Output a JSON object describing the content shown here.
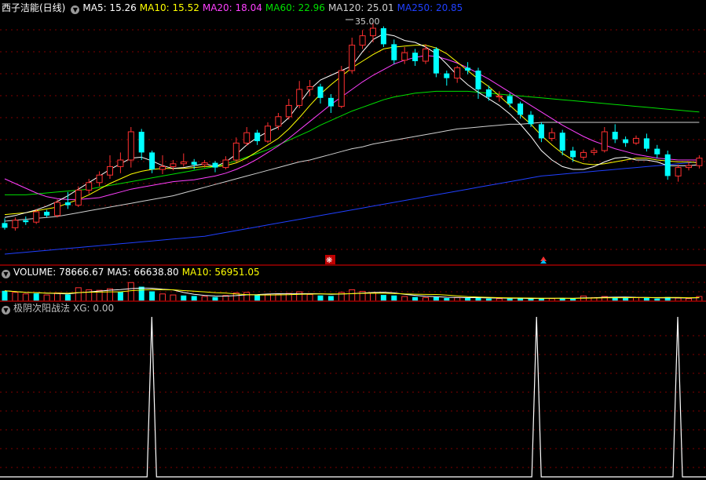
{
  "main_panel": {
    "title": "西子洁能(日线)",
    "ma_items": [
      {
        "label": "MA5: 15.26",
        "color": "#ffffff"
      },
      {
        "label": "MA10: 15.52",
        "color": "#ffff00"
      },
      {
        "label": "MA20: 18.04",
        "color": "#ff40ff"
      },
      {
        "label": "MA60: 22.96",
        "color": "#00e000"
      },
      {
        "label": "MA120: 25.01",
        "color": "#d0d0d0"
      },
      {
        "label": "MA250: 20.85",
        "color": "#2040ff"
      }
    ],
    "peak_label": "35.00",
    "marker_symbol": "❋"
  },
  "volume_panel": {
    "items": [
      {
        "label": "VOLUME: 78666.67",
        "color": "#ffffff"
      },
      {
        "label": "MA5: 66638.80",
        "color": "#ffffff"
      },
      {
        "label": "MA10: 56951.05",
        "color": "#ffff00"
      }
    ]
  },
  "indicator_panel": {
    "title": "极阴次阳战法",
    "value": "XG: 0.00",
    "title_color": "#c0c0c0"
  },
  "colors": {
    "up": "#ff3030",
    "down": "#00ffff",
    "grid": "#800000",
    "separator": "#a00000"
  },
  "chart_data": {
    "type": "candlestick",
    "price_range": [
      10.5,
      36.5
    ],
    "ma_series": {
      "ma5": [
        14.9,
        15.1,
        15.4,
        15.7,
        16.1,
        16.6,
        17.2,
        17.9,
        18.6,
        19.3,
        20.0,
        20.6,
        21.2,
        21.3,
        20.9,
        20.4,
        20.1,
        20.2,
        20.4,
        20.6,
        20.3,
        20.8,
        21.6,
        22.6,
        23.4,
        24.0,
        24.5,
        25.5,
        27.0,
        28.5,
        29.5,
        30.0,
        30.5,
        31.0,
        32.5,
        33.8,
        34.4,
        34.2,
        33.7,
        33.5,
        33.0,
        32.3,
        31.2,
        30.0,
        29.0,
        28.2,
        27.5,
        26.8,
        25.9,
        24.8,
        23.5,
        22.0,
        21.0,
        20.3,
        20.0,
        20.0,
        20.3,
        20.8,
        21.2,
        21.3,
        21.0,
        21.0,
        20.8,
        20.4,
        20.4,
        20.4,
        20.5
      ],
      "ma10": [
        15.2,
        15.3,
        15.4,
        15.6,
        15.8,
        16.0,
        16.4,
        16.8,
        17.3,
        17.9,
        18.5,
        19.0,
        19.5,
        19.8,
        20.0,
        20.1,
        20.1,
        20.1,
        20.2,
        20.3,
        20.3,
        20.4,
        20.7,
        21.2,
        21.9,
        22.6,
        23.3,
        24.3,
        25.5,
        26.8,
        28.0,
        29.0,
        29.9,
        30.8,
        31.5,
        32.2,
        32.8,
        33.0,
        33.1,
        33.2,
        33.2,
        32.9,
        32.3,
        31.4,
        30.5,
        29.6,
        28.8,
        27.8,
        26.8,
        25.8,
        24.8,
        23.6,
        22.6,
        21.7,
        21.0,
        20.6,
        20.5,
        20.6,
        20.8,
        21.0,
        21.2,
        21.2,
        21.0,
        20.9,
        20.8,
        20.8,
        20.7
      ],
      "ma20": [
        19.0,
        18.5,
        18.0,
        17.5,
        17.1,
        16.9,
        16.8,
        16.8,
        16.9,
        17.0,
        17.3,
        17.6,
        17.9,
        18.1,
        18.3,
        18.5,
        18.7,
        18.8,
        18.9,
        19.1,
        19.3,
        19.6,
        20.0,
        20.5,
        21.1,
        21.8,
        22.5,
        23.3,
        24.2,
        25.1,
        26.0,
        26.9,
        27.7,
        28.5,
        29.3,
        30.0,
        30.6,
        31.2,
        31.6,
        31.9,
        32.1,
        32.0,
        31.7,
        31.3,
        30.8,
        30.2,
        29.6,
        28.9,
        28.2,
        27.5,
        26.8,
        26.1,
        25.4,
        24.7,
        24.1,
        23.5,
        23.0,
        22.6,
        22.2,
        21.9,
        21.6,
        21.4,
        21.2,
        21.1,
        21.0,
        21.0,
        21.0
      ],
      "ma60": [
        17.3,
        17.3,
        17.3,
        17.4,
        17.5,
        17.6,
        17.7,
        17.8,
        17.9,
        18.1,
        18.3,
        18.5,
        18.7,
        18.9,
        19.1,
        19.3,
        19.5,
        19.7,
        19.9,
        20.1,
        20.3,
        20.6,
        20.9,
        21.3,
        21.7,
        22.1,
        22.6,
        23.1,
        23.6,
        24.1,
        24.7,
        25.2,
        25.7,
        26.2,
        26.6,
        27.0,
        27.4,
        27.7,
        27.9,
        28.1,
        28.2,
        28.3,
        28.3,
        28.3,
        28.3,
        28.2,
        28.1,
        28.0,
        27.9,
        27.8,
        27.7,
        27.6,
        27.5,
        27.4,
        27.3,
        27.2,
        27.1,
        27.0,
        26.9,
        26.8,
        26.7,
        26.6,
        26.5,
        26.4,
        26.3,
        26.2,
        26.1
      ],
      "ma120": [
        14.5,
        14.6,
        14.7,
        14.8,
        14.9,
        15.0,
        15.2,
        15.4,
        15.6,
        15.8,
        16.0,
        16.2,
        16.4,
        16.6,
        16.8,
        17.0,
        17.2,
        17.5,
        17.8,
        18.1,
        18.4,
        18.7,
        19.0,
        19.3,
        19.6,
        19.9,
        20.2,
        20.5,
        20.8,
        21.0,
        21.3,
        21.6,
        21.9,
        22.2,
        22.4,
        22.7,
        22.9,
        23.1,
        23.3,
        23.5,
        23.7,
        23.9,
        24.1,
        24.3,
        24.4,
        24.5,
        24.6,
        24.7,
        24.8,
        24.8,
        24.9,
        25.0,
        25.0,
        25.0,
        25.0,
        25.0,
        25.0,
        25.0,
        25.0,
        25.0,
        25.0,
        25.0,
        25.0,
        25.0,
        25.0,
        25.0,
        25.0
      ],
      "ma250": [
        11.0,
        11.1,
        11.2,
        11.3,
        11.4,
        11.5,
        11.6,
        11.7,
        11.8,
        11.9,
        12.0,
        12.1,
        12.2,
        12.3,
        12.4,
        12.5,
        12.6,
        12.7,
        12.8,
        12.9,
        13.1,
        13.3,
        13.5,
        13.7,
        13.9,
        14.1,
        14.3,
        14.5,
        14.7,
        14.9,
        15.1,
        15.3,
        15.5,
        15.7,
        15.9,
        16.1,
        16.3,
        16.5,
        16.7,
        16.9,
        17.1,
        17.3,
        17.5,
        17.7,
        17.9,
        18.1,
        18.3,
        18.5,
        18.7,
        18.9,
        19.1,
        19.3,
        19.4,
        19.5,
        19.6,
        19.7,
        19.8,
        19.9,
        20.0,
        20.1,
        20.2,
        20.3,
        20.4,
        20.5,
        20.6,
        20.7,
        20.85
      ]
    },
    "candles_ohlc": [
      [
        14.3,
        13.8,
        14.8,
        13.6
      ],
      [
        13.8,
        14.6,
        14.9,
        13.5
      ],
      [
        14.6,
        14.4,
        15.0,
        14.1
      ],
      [
        14.4,
        15.5,
        15.8,
        14.2
      ],
      [
        15.5,
        15.1,
        15.7,
        14.9
      ],
      [
        15.1,
        16.5,
        16.8,
        14.9
      ],
      [
        16.5,
        16.2,
        17.6,
        15.8
      ],
      [
        16.2,
        17.8,
        18.2,
        16.0
      ],
      [
        17.8,
        18.6,
        19.0,
        17.4
      ],
      [
        18.6,
        19.4,
        19.8,
        18.2
      ],
      [
        19.4,
        20.3,
        21.5,
        19.0
      ],
      [
        20.3,
        21.0,
        21.8,
        19.6
      ],
      [
        21.0,
        24.0,
        24.5,
        20.2
      ],
      [
        24.0,
        21.8,
        24.3,
        21.0
      ],
      [
        21.8,
        20.0,
        22.0,
        19.6
      ],
      [
        20.0,
        20.3,
        21.5,
        19.5
      ],
      [
        20.3,
        20.6,
        21.0,
        19.9
      ],
      [
        20.6,
        20.8,
        21.7,
        20.3
      ],
      [
        20.8,
        20.5,
        21.1,
        20.0
      ],
      [
        20.5,
        20.7,
        21.0,
        20.2
      ],
      [
        20.7,
        20.2,
        20.9,
        19.7
      ],
      [
        20.2,
        21.0,
        21.4,
        20.0
      ],
      [
        21.0,
        22.8,
        23.4,
        20.8
      ],
      [
        22.8,
        23.9,
        24.5,
        22.5
      ],
      [
        23.9,
        23.0,
        24.2,
        22.6
      ],
      [
        23.0,
        24.6,
        25.0,
        22.8
      ],
      [
        24.6,
        25.6,
        26.0,
        24.2
      ],
      [
        25.6,
        26.8,
        27.5,
        25.3
      ],
      [
        26.8,
        28.5,
        29.4,
        26.5
      ],
      [
        28.5,
        28.8,
        29.5,
        27.8
      ],
      [
        28.8,
        27.6,
        29.1,
        27.0
      ],
      [
        27.6,
        26.7,
        28.0,
        26.0
      ],
      [
        26.7,
        30.5,
        31.0,
        26.5
      ],
      [
        30.5,
        33.2,
        34.0,
        30.2
      ],
      [
        33.2,
        34.2,
        34.8,
        32.8
      ],
      [
        34.2,
        35.0,
        35.5,
        33.5
      ],
      [
        35.0,
        33.3,
        35.2,
        33.0
      ],
      [
        33.3,
        31.6,
        33.8,
        31.2
      ],
      [
        31.6,
        32.4,
        33.0,
        31.2
      ],
      [
        32.4,
        31.5,
        32.8,
        31.0
      ],
      [
        31.5,
        32.8,
        33.3,
        31.2
      ],
      [
        32.8,
        30.2,
        33.0,
        29.8
      ],
      [
        30.2,
        29.7,
        30.5,
        28.9
      ],
      [
        29.7,
        30.8,
        31.0,
        29.2
      ],
      [
        30.8,
        30.5,
        31.4,
        30.1
      ],
      [
        30.5,
        28.5,
        30.8,
        27.5
      ],
      [
        28.5,
        27.7,
        28.9,
        27.3
      ],
      [
        27.7,
        27.8,
        28.3,
        27.2
      ],
      [
        27.8,
        27.0,
        28.1,
        26.6
      ],
      [
        27.0,
        25.8,
        27.2,
        25.4
      ],
      [
        25.8,
        24.8,
        26.2,
        24.5
      ],
      [
        24.8,
        23.3,
        25.0,
        22.9
      ],
      [
        23.3,
        23.9,
        24.4,
        23.0
      ],
      [
        23.9,
        22.0,
        24.2,
        21.5
      ],
      [
        22.0,
        21.3,
        22.4,
        20.8
      ],
      [
        21.3,
        21.8,
        22.1,
        21.0
      ],
      [
        21.8,
        22.0,
        22.3,
        21.5
      ],
      [
        22.0,
        24.0,
        24.5,
        21.8
      ],
      [
        24.0,
        23.2,
        24.8,
        22.8
      ],
      [
        23.2,
        22.8,
        23.5,
        22.4
      ],
      [
        22.8,
        23.3,
        23.6,
        22.6
      ],
      [
        23.3,
        22.2,
        23.8,
        21.9
      ],
      [
        22.2,
        21.6,
        22.6,
        21.2
      ],
      [
        21.6,
        19.3,
        22.0,
        18.9
      ],
      [
        19.3,
        20.2,
        20.5,
        18.7
      ],
      [
        20.2,
        20.4,
        20.8,
        19.9
      ],
      [
        20.4,
        21.2,
        21.5,
        20.1
      ]
    ],
    "volume": [
      {
        "v": 1.0,
        "up": false
      },
      {
        "v": 0.85,
        "up": true
      },
      {
        "v": 0.7,
        "up": true
      },
      {
        "v": 0.75,
        "up": false
      },
      {
        "v": 0.6,
        "up": true
      },
      {
        "v": 0.8,
        "up": true
      },
      {
        "v": 0.65,
        "up": false
      },
      {
        "v": 1.3,
        "up": true
      },
      {
        "v": 1.1,
        "up": true
      },
      {
        "v": 1.05,
        "up": true
      },
      {
        "v": 1.2,
        "up": true
      },
      {
        "v": 0.9,
        "up": false
      },
      {
        "v": 1.8,
        "up": true
      },
      {
        "v": 1.4,
        "up": false
      },
      {
        "v": 0.95,
        "up": false
      },
      {
        "v": 0.7,
        "up": true
      },
      {
        "v": 0.6,
        "up": true
      },
      {
        "v": 0.55,
        "up": false
      },
      {
        "v": 0.5,
        "up": false
      },
      {
        "v": 0.45,
        "up": true
      },
      {
        "v": 0.4,
        "up": false
      },
      {
        "v": 0.55,
        "up": true
      },
      {
        "v": 0.8,
        "up": true
      },
      {
        "v": 0.85,
        "up": true
      },
      {
        "v": 0.6,
        "up": false
      },
      {
        "v": 0.65,
        "up": true
      },
      {
        "v": 0.7,
        "up": true
      },
      {
        "v": 0.75,
        "up": true
      },
      {
        "v": 0.9,
        "up": true
      },
      {
        "v": 0.65,
        "up": true
      },
      {
        "v": 0.55,
        "up": false
      },
      {
        "v": 0.5,
        "up": false
      },
      {
        "v": 0.85,
        "up": true
      },
      {
        "v": 1.1,
        "up": true
      },
      {
        "v": 0.95,
        "up": true
      },
      {
        "v": 0.8,
        "up": true
      },
      {
        "v": 0.6,
        "up": false
      },
      {
        "v": 0.55,
        "up": false
      },
      {
        "v": 0.45,
        "up": true
      },
      {
        "v": 0.4,
        "up": false
      },
      {
        "v": 0.35,
        "up": true
      },
      {
        "v": 0.4,
        "up": false
      },
      {
        "v": 0.3,
        "up": false
      },
      {
        "v": 0.35,
        "up": true
      },
      {
        "v": 0.3,
        "up": false
      },
      {
        "v": 0.35,
        "up": false
      },
      {
        "v": 0.25,
        "up": false
      },
      {
        "v": 0.25,
        "up": true
      },
      {
        "v": 0.25,
        "up": false
      },
      {
        "v": 0.3,
        "up": false
      },
      {
        "v": 0.25,
        "up": false
      },
      {
        "v": 0.3,
        "up": false
      },
      {
        "v": 0.25,
        "up": true
      },
      {
        "v": 0.3,
        "up": false
      },
      {
        "v": 0.25,
        "up": false
      },
      {
        "v": 0.5,
        "up": true
      },
      {
        "v": 0.35,
        "up": true
      },
      {
        "v": 0.45,
        "up": true
      },
      {
        "v": 0.4,
        "up": false
      },
      {
        "v": 0.3,
        "up": false
      },
      {
        "v": 0.35,
        "up": true
      },
      {
        "v": 0.3,
        "up": false
      },
      {
        "v": 0.25,
        "up": false
      },
      {
        "v": 0.4,
        "up": false
      },
      {
        "v": 0.3,
        "up": true
      },
      {
        "v": 0.25,
        "up": true
      },
      {
        "v": 0.45,
        "up": true
      }
    ],
    "signal_spikes_at": [
      21.5,
      76.0,
      96.0
    ],
    "xg_range": [
      0,
      1
    ]
  }
}
